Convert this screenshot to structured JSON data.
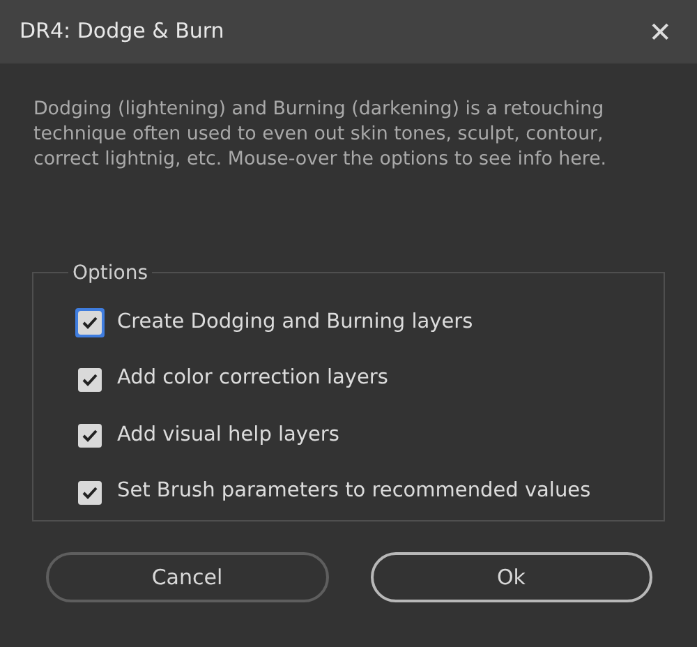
{
  "window": {
    "title": "DR4: Dodge & Burn",
    "close": "✕"
  },
  "description": "Dodging (lightening) and Burning (darkening) is a retouching technique often used to even out skin tones, sculpt, contour, correct lightnig, etc. Mouse-over the options to see info here.",
  "options": {
    "legend": "Options",
    "items": [
      {
        "label": "Create Dodging and Burning layers",
        "checked": true,
        "focused": true
      },
      {
        "label": "Add color correction layers",
        "checked": true,
        "focused": false
      },
      {
        "label": "Add visual help layers",
        "checked": true,
        "focused": false
      },
      {
        "label": "Set Brush parameters to recommended values",
        "checked": true,
        "focused": false
      }
    ]
  },
  "buttons": [
    {
      "label": "Cancel",
      "default": false
    },
    {
      "label": "Ok",
      "default": true
    }
  ]
}
